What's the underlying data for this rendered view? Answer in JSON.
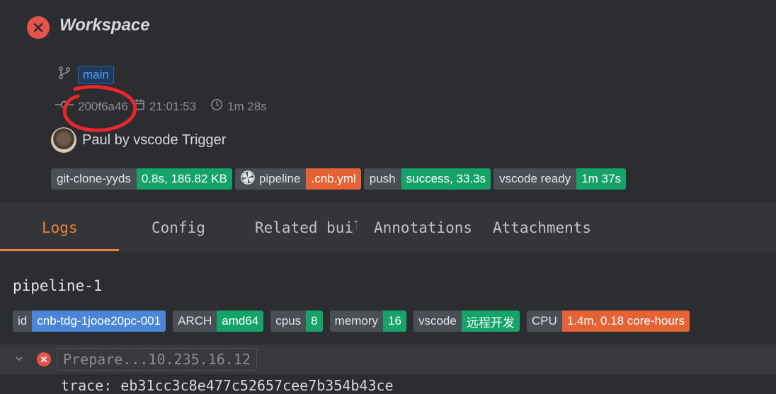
{
  "header": {
    "title": "Workspace"
  },
  "build": {
    "branch": "main",
    "commit": "200f6a46",
    "time": "21:01:53",
    "duration": "1m 28s",
    "author": "Paul by vscode Trigger"
  },
  "badges": [
    {
      "key": "git-clone-yyds",
      "value": "0.8s, 186.82 KB",
      "color": "#15a36a"
    },
    {
      "key": "pipeline",
      "value": ".cnb.yml",
      "color": "#e56236"
    },
    {
      "key": "push",
      "value": "success, 33.3s",
      "color": "#15a36a"
    },
    {
      "key": "vscode ready",
      "value": "1m 37s",
      "color": "#15a36a"
    }
  ],
  "tabs": [
    "Logs",
    "Config",
    "Related builds",
    "Annotations",
    "Attachments"
  ],
  "pipeline": {
    "name": "pipeline-1",
    "props": [
      {
        "key": "id",
        "value": "cnb-tdg-1jooe20pc-001"
      },
      {
        "key": "ARCH",
        "value": "amd64"
      },
      {
        "key": "cpus",
        "value": "8"
      },
      {
        "key": "memory",
        "value": "16"
      },
      {
        "key": "vscode",
        "value": "远程开发"
      },
      {
        "key": "CPU",
        "value": "1.4m, 0.18 core-hours"
      }
    ],
    "step": "Prepare...10.235.16.12",
    "trace": "trace: eb31cc3c8e477c52657cee7b354b43ce"
  },
  "colors": {
    "error": "#e5534b",
    "accent": "#f0823d",
    "success": "#15a36a",
    "warning": "#e56236",
    "info": "#4b86d6"
  }
}
